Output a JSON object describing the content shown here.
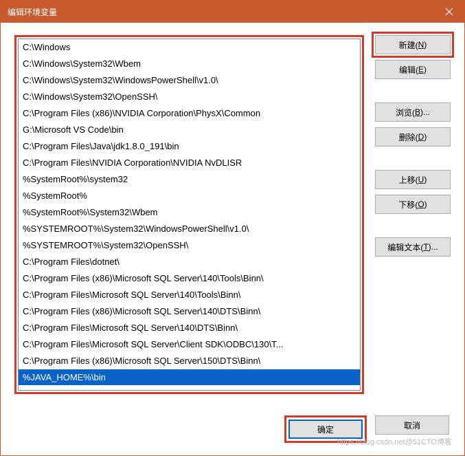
{
  "window": {
    "title": "编辑环境变量"
  },
  "list": {
    "items": [
      "C:\\Windows",
      "C:\\Windows\\System32\\Wbem",
      "C:\\Windows\\System32\\WindowsPowerShell\\v1.0\\",
      "C:\\Windows\\System32\\OpenSSH\\",
      "C:\\Program Files (x86)\\NVIDIA Corporation\\PhysX\\Common",
      "G:\\Microsoft VS Code\\bin",
      "C:\\Program Files\\Java\\jdk1.8.0_191\\bin",
      "C:\\Program Files\\NVIDIA Corporation\\NVIDIA NvDLISR",
      "%SystemRoot%\\system32",
      "%SystemRoot%",
      "%SystemRoot%\\System32\\Wbem",
      "%SYSTEMROOT%\\System32\\WindowsPowerShell\\v1.0\\",
      "%SYSTEMROOT%\\System32\\OpenSSH\\",
      "C:\\Program Files\\dotnet\\",
      "C:\\Program Files (x86)\\Microsoft SQL Server\\140\\Tools\\Binn\\",
      "C:\\Program Files\\Microsoft SQL Server\\140\\Tools\\Binn\\",
      "C:\\Program Files (x86)\\Microsoft SQL Server\\140\\DTS\\Binn\\",
      "C:\\Program Files\\Microsoft SQL Server\\140\\DTS\\Binn\\",
      "C:\\Program Files\\Microsoft SQL Server\\Client SDK\\ODBC\\130\\T...",
      "C:\\Program Files (x86)\\Microsoft SQL Server\\150\\DTS\\Binn\\"
    ],
    "edit_value": "%JAVA_HOME%\\bin"
  },
  "buttons": {
    "new": {
      "label": "新建(",
      "key": "N",
      "suffix": ")"
    },
    "edit": {
      "label": "编辑(",
      "key": "E",
      "suffix": ")"
    },
    "browse": {
      "label": "浏览(",
      "key": "B",
      "suffix": ")..."
    },
    "delete": {
      "label": "删除(",
      "key": "D",
      "suffix": ")"
    },
    "moveup": {
      "label": "上移(",
      "key": "U",
      "suffix": ")"
    },
    "movedown": {
      "label": "下移(",
      "key": "O",
      "suffix": ")"
    },
    "edittext": {
      "label": "编辑文本(",
      "key": "T",
      "suffix": ")..."
    },
    "ok": "确定",
    "cancel": "取消"
  },
  "watermark": "https://blog.csdn.net@51CTO博客"
}
